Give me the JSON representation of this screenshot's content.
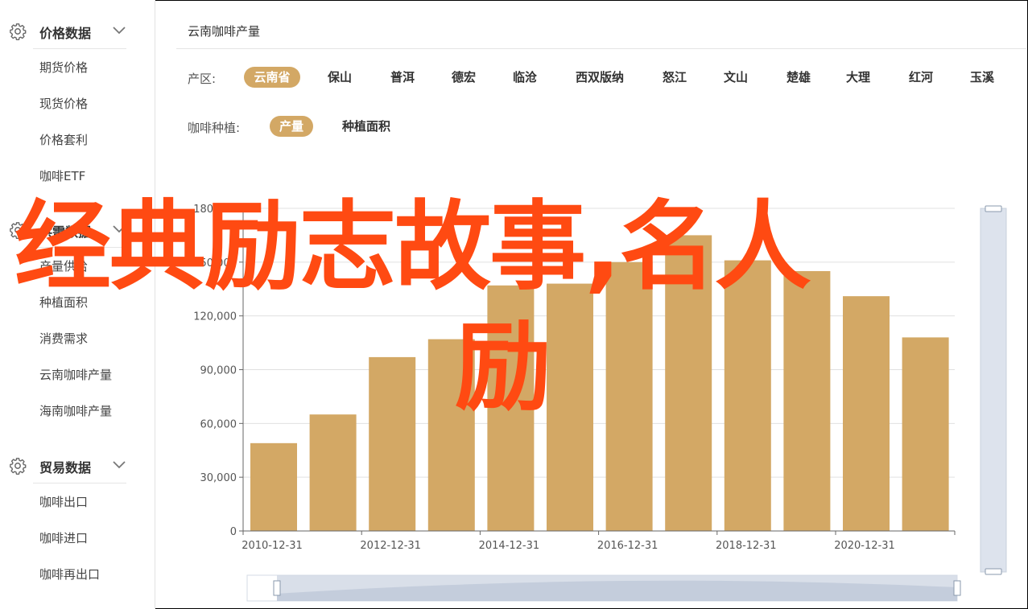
{
  "sidebar": {
    "groups": [
      {
        "title": "价格数据",
        "icon": "gear-icon",
        "items": [
          "期货价格",
          "现货价格",
          "价格套利",
          "咖啡ETF"
        ]
      },
      {
        "title": "供需数据",
        "icon": "gear-icon",
        "items": [
          "产量供给",
          "种植面积",
          "消费需求",
          "云南咖啡产量",
          "海南咖啡产量"
        ]
      },
      {
        "title": "贸易数据",
        "icon": "gear-icon",
        "items": [
          "咖啡出口",
          "咖啡进口",
          "咖啡再出口"
        ]
      }
    ]
  },
  "main": {
    "breadcrumb": "云南咖啡产量",
    "region_filter": {
      "label": "产区:",
      "options": [
        "云南省",
        "保山",
        "普洱",
        "德宏",
        "临沧",
        "西双版纳",
        "怒江",
        "文山",
        "楚雄",
        "大理",
        "红河",
        "玉溪"
      ],
      "selected": "云南省"
    },
    "metric_filter": {
      "label": "咖啡种植:",
      "options": [
        "产量",
        "种植面积"
      ],
      "selected": "产量"
    }
  },
  "overlay_text": {
    "line1": "经典励志故事,名人",
    "line2": "励"
  },
  "colors": {
    "accent": "#d3a865",
    "bar": "#d3a865",
    "overlay": "#ff4a12"
  },
  "chart_data": {
    "type": "bar",
    "x": [
      "2010-12-31",
      "2011-12-31",
      "2012-12-31",
      "2013-12-31",
      "2014-12-31",
      "2015-12-31",
      "2016-12-31",
      "2017-12-31",
      "2018-12-31",
      "2019-12-31",
      "2020-12-31",
      "2021-12-31"
    ],
    "x_tick_labels": [
      "2010-12-31",
      "2012-12-31",
      "2014-12-31",
      "2016-12-31",
      "2018-12-31",
      "2020-12-31"
    ],
    "values": [
      49000,
      65000,
      97000,
      107000,
      137000,
      138000,
      150000,
      165000,
      151000,
      145000,
      131000,
      108000
    ],
    "ylim": [
      0,
      180000
    ],
    "yticks": [
      0,
      30000,
      60000,
      90000,
      120000,
      150000,
      180000
    ],
    "ytick_labels": [
      "0",
      "30,000",
      "60,000",
      "90,000",
      "120,000",
      "150,000",
      "180,000"
    ],
    "grid": true
  }
}
